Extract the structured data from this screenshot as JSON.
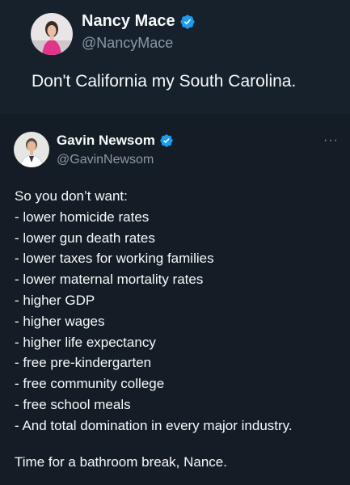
{
  "quoted_tweet": {
    "name": "Nancy Mace",
    "handle": "@NancyMace",
    "text": "Don't California my South Carolina."
  },
  "tweet": {
    "name": "Gavin Newsom",
    "handle": "@GavinNewsom",
    "more_label": "···",
    "lines": [
      "So you don’t want:",
      "- lower homicide rates",
      "- lower gun death rates",
      "- lower taxes for working families",
      "- lower maternal mortality rates",
      "- higher GDP",
      "- higher wages",
      "- higher life expectancy",
      "- free pre-kindergarten",
      "- free community college",
      "- free school meals",
      "- And total domination in every major industry."
    ],
    "closing": "Time for a bathroom break, Nance."
  },
  "colors": {
    "background": "#141d26",
    "text": "#f7f9f9",
    "secondary_text": "#8b98a5",
    "verified_badge": "#1d9bf0"
  },
  "icons": {
    "verified": "verified-badge-icon",
    "more": "more-options-icon"
  }
}
